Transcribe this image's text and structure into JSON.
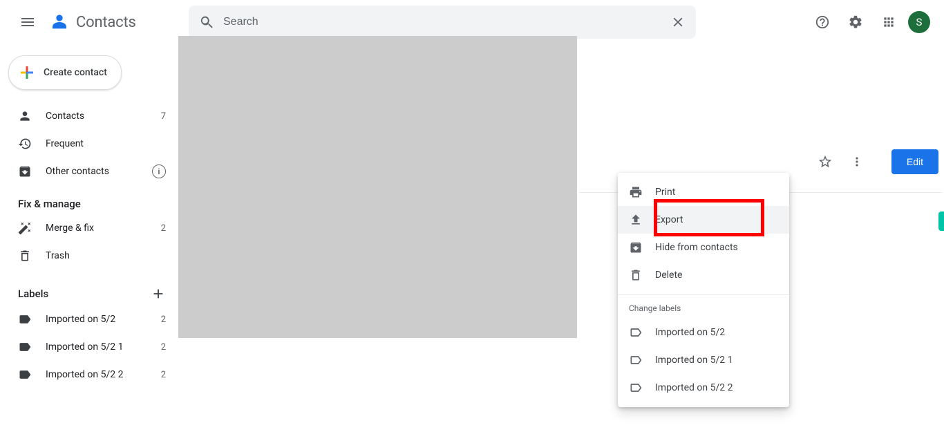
{
  "header": {
    "app_name": "Contacts",
    "search_placeholder": "Search",
    "avatar_initial": "S"
  },
  "sidebar": {
    "create_label": "Create contact",
    "nav": [
      {
        "label": "Contacts",
        "count": "7"
      },
      {
        "label": "Frequent",
        "count": ""
      },
      {
        "label": "Other contacts",
        "count": ""
      }
    ],
    "fix_header": "Fix & manage",
    "fix_items": [
      {
        "label": "Merge & fix",
        "count": "2"
      },
      {
        "label": "Trash",
        "count": ""
      }
    ],
    "labels_header": "Labels",
    "labels": [
      {
        "label": "Imported on 5/2",
        "count": "2"
      },
      {
        "label": "Imported on 5/2 1",
        "count": "2"
      },
      {
        "label": "Imported on 5/2 2",
        "count": "2"
      }
    ]
  },
  "actions": {
    "edit": "Edit"
  },
  "menu": {
    "print": "Print",
    "export": "Export",
    "hide": "Hide from contacts",
    "delete": "Delete",
    "change_labels_header": "Change labels",
    "labels": [
      "Imported on 5/2",
      "Imported on 5/2 1",
      "Imported on 5/2 2"
    ]
  }
}
